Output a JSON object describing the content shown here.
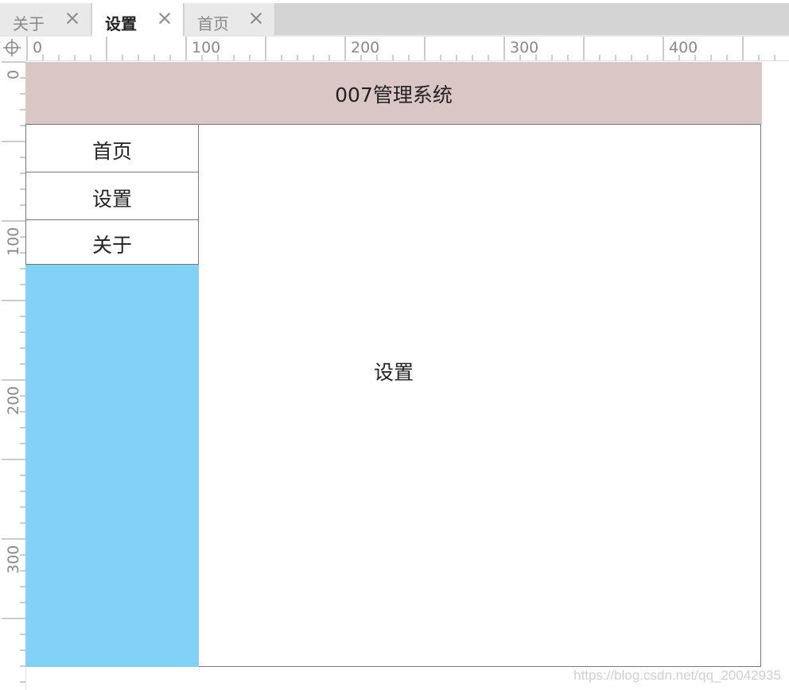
{
  "tabs": [
    {
      "label": "关于",
      "active": false
    },
    {
      "label": "设置",
      "active": true
    },
    {
      "label": "首页",
      "active": false
    }
  ],
  "ruler": {
    "horizontal_labels": [
      "0",
      "100",
      "200",
      "300",
      "400"
    ],
    "vertical_labels": [
      "0",
      "100",
      "200",
      "300"
    ]
  },
  "header": {
    "title": "007管理系统",
    "background": "#dbc6c6"
  },
  "sidebar": {
    "background": "#82d1f6",
    "items": [
      {
        "label": "首页"
      },
      {
        "label": "设置"
      },
      {
        "label": "关于"
      }
    ]
  },
  "main": {
    "text": "设置"
  },
  "watermark": "https://blog.csdn.net/qq_20042935"
}
